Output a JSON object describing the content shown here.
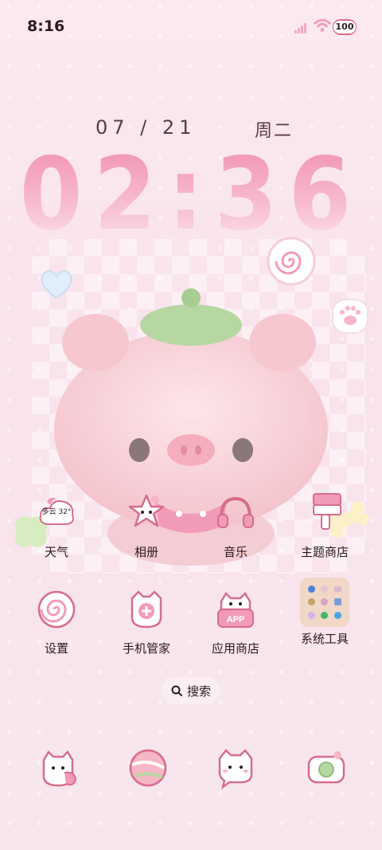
{
  "status_bar": {
    "time": "8:16",
    "battery": "100"
  },
  "lock_widget": {
    "date": "07 / 21",
    "weekday": "周二",
    "clock": "02:36"
  },
  "weather": {
    "condition": "多云",
    "temperature": "32°"
  },
  "apps": [
    {
      "label": "天气",
      "icon": "weather-icon"
    },
    {
      "label": "相册",
      "icon": "gallery-icon"
    },
    {
      "label": "音乐",
      "icon": "music-icon"
    },
    {
      "label": "主题商店",
      "icon": "theme-store-icon"
    },
    {
      "label": "设置",
      "icon": "settings-icon"
    },
    {
      "label": "手机管家",
      "icon": "phone-manager-icon"
    },
    {
      "label": "应用商店",
      "icon": "app-store-icon"
    },
    {
      "label": "系统工具",
      "icon": "system-tools-folder"
    }
  ],
  "app_store_badge": "APP",
  "search": {
    "label": "搜索"
  },
  "dock": [
    {
      "icon": "phone-icon"
    },
    {
      "icon": "browser-icon"
    },
    {
      "icon": "messages-icon"
    },
    {
      "icon": "camera-icon"
    }
  ],
  "colors": {
    "accent": "#f29bb8",
    "text": "#2b1a22",
    "background": "#f9e3ec"
  }
}
